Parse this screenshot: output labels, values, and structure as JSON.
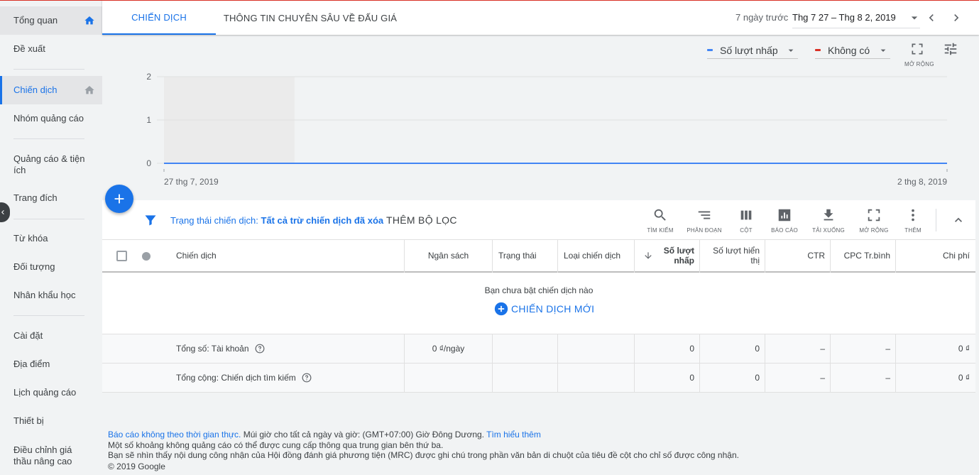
{
  "sidebar": {
    "items": [
      {
        "label": "Tổng quan",
        "icon": "home-icon"
      },
      {
        "label": "Đề xuất"
      },
      {
        "label": "Chiến dịch",
        "icon": "home-icon"
      },
      {
        "label": "Nhóm quảng cáo"
      },
      {
        "label": "Quảng cáo & tiện ích"
      },
      {
        "label": "Trang đích"
      },
      {
        "label": "Từ khóa"
      },
      {
        "label": "Đối tượng"
      },
      {
        "label": "Nhân khẩu học"
      },
      {
        "label": "Cài đặt"
      },
      {
        "label": "Địa điểm"
      },
      {
        "label": "Lịch quảng cáo"
      },
      {
        "label": "Thiết bị"
      },
      {
        "label": "Điều chỉnh giá thầu nâng cao"
      }
    ]
  },
  "tabs": [
    {
      "label": "CHIẾN DỊCH",
      "active": true
    },
    {
      "label": "THÔNG TIN CHUYÊN SÂU VỀ ĐẤU GIÁ",
      "active": false
    }
  ],
  "date": {
    "hint": "7 ngày trước",
    "range": "Thg 7 27 – Thg 8 2, 2019"
  },
  "chart_controls": {
    "metric1": {
      "label": "Số lượt nhấp",
      "color": "#4285f4"
    },
    "metric2": {
      "label": "Không có",
      "color": "#d93025"
    },
    "expand_label": "MỞ RỘNG"
  },
  "chart_data": {
    "type": "line",
    "series": [
      {
        "name": "Số lượt nhấp",
        "x": [
          "27 thg 7, 2019",
          "2 thg 8, 2019"
        ],
        "values": [
          0,
          0
        ]
      }
    ],
    "yticks": [
      "0",
      "1",
      "2"
    ],
    "ylim": [
      0,
      2
    ],
    "xtick_labels": [
      "27 thg 7, 2019",
      "2 thg 8, 2019"
    ],
    "grid": true,
    "highlight_band": "first day"
  },
  "filter": {
    "prefix": "Trạng thái chiến dịch: ",
    "value": "Tất cả trừ chiến dịch đã xóa",
    "add_filter": "THÊM BỘ LỌC"
  },
  "tools": [
    {
      "label": "TÌM KIẾM",
      "icon": "search-icon"
    },
    {
      "label": "PHÂN ĐOẠN",
      "icon": "segment-icon"
    },
    {
      "label": "CỘT",
      "icon": "columns-icon"
    },
    {
      "label": "BÁO CÁO",
      "icon": "report-icon"
    },
    {
      "label": "TẢI XUỐNG",
      "icon": "download-icon"
    },
    {
      "label": "MỞ RỘNG",
      "icon": "expand-icon"
    },
    {
      "label": "THÊM",
      "icon": "more-icon"
    }
  ],
  "table": {
    "headers": {
      "campaign": "Chiến dịch",
      "budget": "Ngân sách",
      "status": "Trạng thái",
      "type": "Loại chiến dịch",
      "clicks": "Số lượt nhấp",
      "impressions": "Số lượt hiển thị",
      "ctr": "CTR",
      "cpc": "CPC Tr.bình",
      "cost": "Chi phí"
    },
    "empty_message": "Bạn chưa bật chiến dịch nào",
    "new_campaign": "CHIẾN DỊCH MỚI",
    "totals": [
      {
        "label": "Tổng số: Tài khoản",
        "budget": "0 ₫/ngày",
        "clicks": "0",
        "impressions": "0",
        "ctr": "–",
        "cpc": "–",
        "cost": "0 ₫"
      },
      {
        "label": "Tổng cộng: Chiến dịch tìm kiếm",
        "budget": "",
        "clicks": "0",
        "impressions": "0",
        "ctr": "–",
        "cpc": "–",
        "cost": "0 ₫"
      }
    ]
  },
  "footer": {
    "line1_link": "Báo cáo không theo thời gian thực.",
    "line1_text": " Múi giờ cho tất cả ngày và giờ: (GMT+07:00) Giờ Đông Dương. ",
    "line1_learn": "Tìm hiểu thêm",
    "line2": "Một số khoảng không quảng cáo có thể được cung cấp thông qua trung gian bên thứ ba.",
    "line3": "Bạn sẽ nhìn thấy nội dung công nhận của Hội đồng đánh giá phương tiện (MRC) được ghi chú trong phần văn bản di chuột của tiêu đề cột cho chỉ số được công nhận.",
    "copyright": "© 2019 Google"
  }
}
